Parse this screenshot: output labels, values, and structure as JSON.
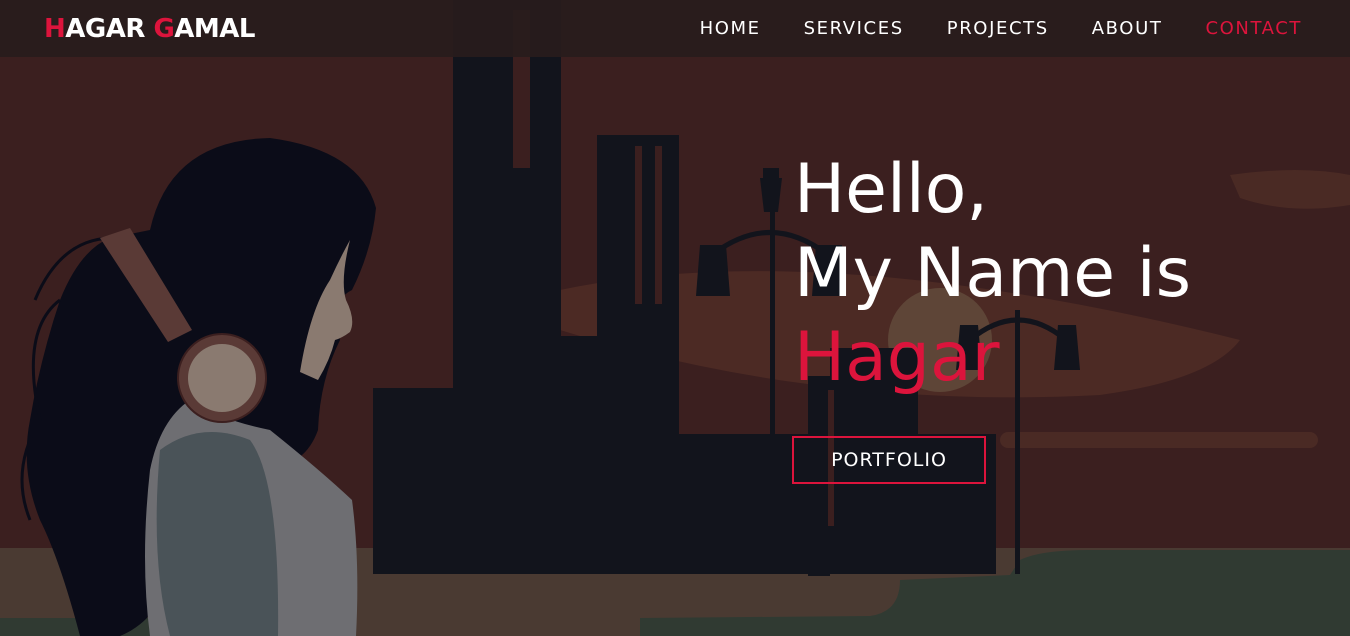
{
  "brand": {
    "first_initial": "H",
    "first_rest": "AGAR ",
    "last_initial": "G",
    "last_rest": "AMAL"
  },
  "nav": {
    "items": [
      {
        "label": "HOME"
      },
      {
        "label": "SERVICES"
      },
      {
        "label": "PROJECTS"
      },
      {
        "label": "ABOUT"
      },
      {
        "label": "CONTACT"
      }
    ],
    "active": "CONTACT"
  },
  "hero": {
    "greeting": "Hello,",
    "intro": "My Name is",
    "name": "Hagar",
    "button_label": "PORTFOLIO"
  },
  "colors": {
    "accent": "#dc143c",
    "text": "#ffffff",
    "background": "#3b1f1f",
    "navbar": "#281c1c"
  },
  "illustration": {
    "subject": "woman-with-headphones-city-silhouette-illustration"
  }
}
